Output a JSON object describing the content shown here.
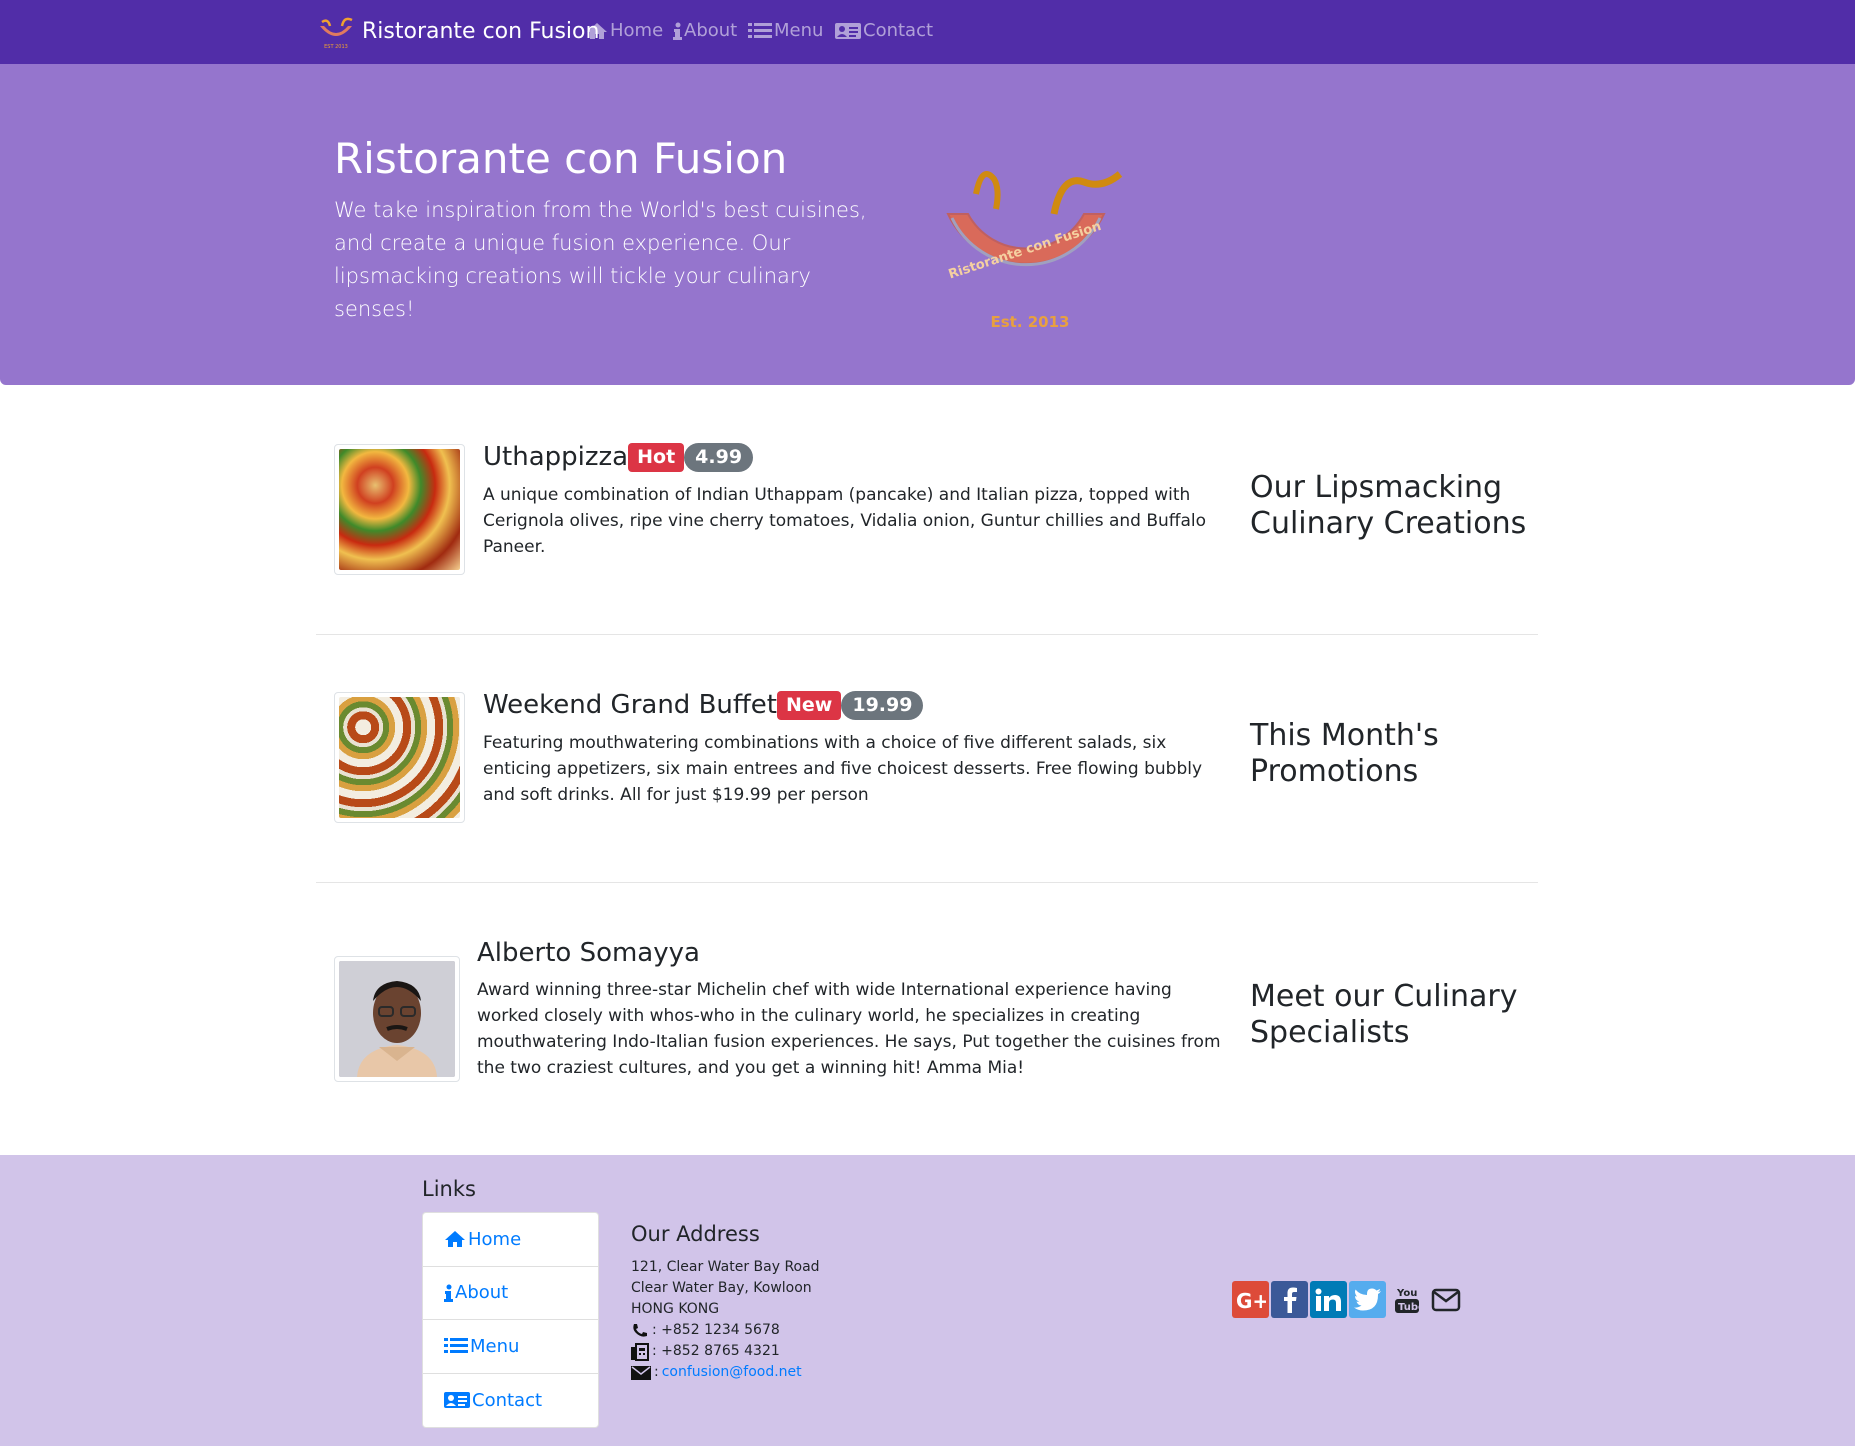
{
  "nav": {
    "brand": "Ristorante con Fusion",
    "items": [
      {
        "label": "Home",
        "icon": "home-icon"
      },
      {
        "label": "About",
        "icon": "info-icon"
      },
      {
        "label": "Menu",
        "icon": "list-icon"
      },
      {
        "label": "Contact",
        "icon": "address-card-icon"
      }
    ]
  },
  "jumbotron": {
    "title": "Ristorante con Fusion",
    "text": "We take inspiration from the World's best cuisines, and create a unique fusion experience. Our lipsmacking creations will tickle your culinary senses!",
    "logo_ring_text": "Ristorante con Fusion",
    "logo_est": "Est. 2013"
  },
  "media": [
    {
      "title": "Uthappizza",
      "badge": "Hot",
      "price": "4.99",
      "text": "A unique combination of Indian Uthappam (pancake) and Italian pizza, topped with Cerignola olives, ripe vine cherry tomatoes, Vidalia onion, Guntur chillies and Buffalo Paneer.",
      "side_heading": "Our Lipsmacking Culinary Creations"
    },
    {
      "title": "Weekend Grand Buffet",
      "badge": "New",
      "price": "19.99",
      "text": "Featuring mouthwatering combinations with a choice of five different salads, six enticing appetizers, six main entrees and five choicest desserts. Free flowing bubbly and soft drinks. All for just $19.99 per person",
      "side_heading": "This Month's Promotions"
    },
    {
      "title": "Alberto Somayya",
      "text": "Award winning three-star Michelin chef with wide International experience having worked closely with whos-who in the culinary world, he specializes in creating mouthwatering Indo-Italian fusion experiences. He says, Put together the cuisines from the two craziest cultures, and you get a winning hit! Amma Mia!",
      "side_heading": "Meet our Culinary Specialists"
    }
  ],
  "footer": {
    "links_title": "Links",
    "links": [
      "Home",
      "About",
      "Menu",
      "Contact"
    ],
    "address_title": "Our Address",
    "address_lines": [
      "121, Clear Water Bay Road",
      "Clear Water Bay, Kowloon",
      "HONG KONG"
    ],
    "phone": ": +852 1234 5678",
    "fax": ": +852 8765 4321",
    "email_prefix": ":",
    "email": "confusion@food.net",
    "social": [
      "google-plus-icon",
      "facebook-icon",
      "linkedin-icon",
      "twitter-icon",
      "youtube-icon",
      "envelope-icon"
    ],
    "colors": {
      "google": "#dd4b39",
      "facebook": "#3b5998",
      "linkedin": "#007bb6",
      "twitter": "#55acee"
    }
  },
  "colors": {
    "navbar": "#512DA8",
    "jumbotron": "#9575CD",
    "footer": "#D1C4E9",
    "badge_danger": "#dc3545",
    "badge_secondary": "#6c757d",
    "link": "#007bff"
  }
}
